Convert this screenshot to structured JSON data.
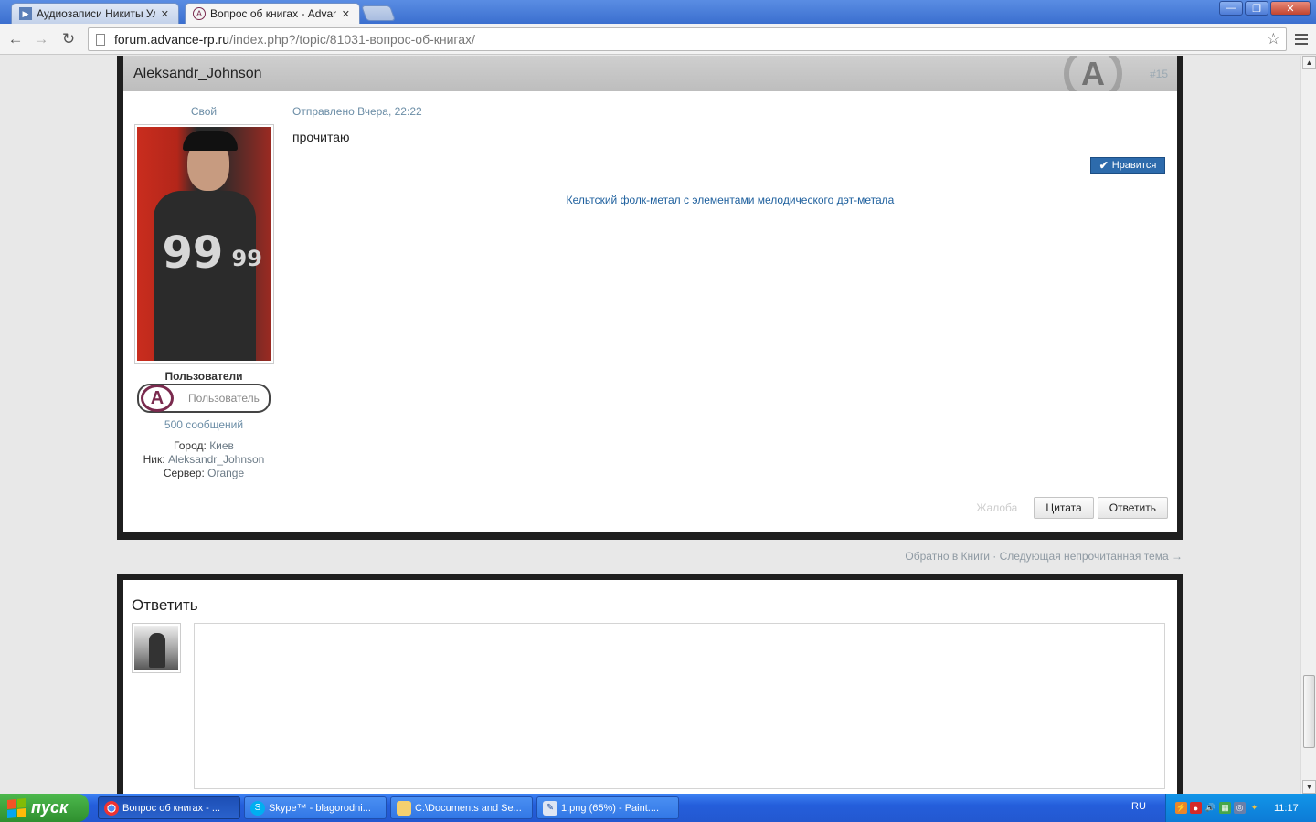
{
  "browser": {
    "tabs": [
      {
        "title": "Аудиозаписи Никиты Ульяно",
        "active": false,
        "icon": "play-icon"
      },
      {
        "title": "Вопрос об книгах - Advance",
        "active": true,
        "icon": "advance-rp-icon"
      }
    ],
    "url_host": "forum.advance-rp.ru",
    "url_path": "/index.php?/topic/81031-вопрос-об-книгах/"
  },
  "post": {
    "author": "Aleksandr_Johnson",
    "number": "#15",
    "author_status": "Свой",
    "group": "Пользователи",
    "group_badge": "Пользователь",
    "post_count": "500 сообщений",
    "fields": [
      {
        "label": "Город:",
        "value": "Киев"
      },
      {
        "label": "Ник:",
        "value": "Aleksandr_Johnson"
      },
      {
        "label": "Сервер:",
        "value": "Orange"
      }
    ],
    "posted": "Отправлено Вчера, 22:22",
    "text": "прочитаю",
    "like_label": "Нравится",
    "signature": "Кельтский фолк-метал с элементами мелодического дэт-метала",
    "report_label": "Жалоба",
    "quote_label": "Цитата",
    "reply_label": "Ответить",
    "avatar_numbers": {
      "big": "99",
      "small": "99"
    }
  },
  "topic_nav": "Обратно в Книги · Следующая непрочитанная тема →",
  "reply_box": {
    "title": "Ответить"
  },
  "taskbar": {
    "start_label": "пуск",
    "tasks": [
      {
        "label": "Вопрос об книгах - ...",
        "icon": "chrome-icon",
        "active": true
      },
      {
        "label": "Skype™ - blagorodni...",
        "icon": "skype-icon",
        "active": false
      },
      {
        "label": "C:\\Documents and Se...",
        "icon": "folder-icon",
        "active": false
      },
      {
        "label": "1.png (65%) - Paint....",
        "icon": "paint-icon",
        "active": false
      }
    ],
    "language": "RU",
    "clock": "11:17"
  },
  "colors": {
    "accent_link": "#1d5f9d",
    "like_button": "#2d6bac",
    "frame": "#1f1f1f",
    "taskbar": "#245edb",
    "start_button": "#2f8f2f"
  }
}
